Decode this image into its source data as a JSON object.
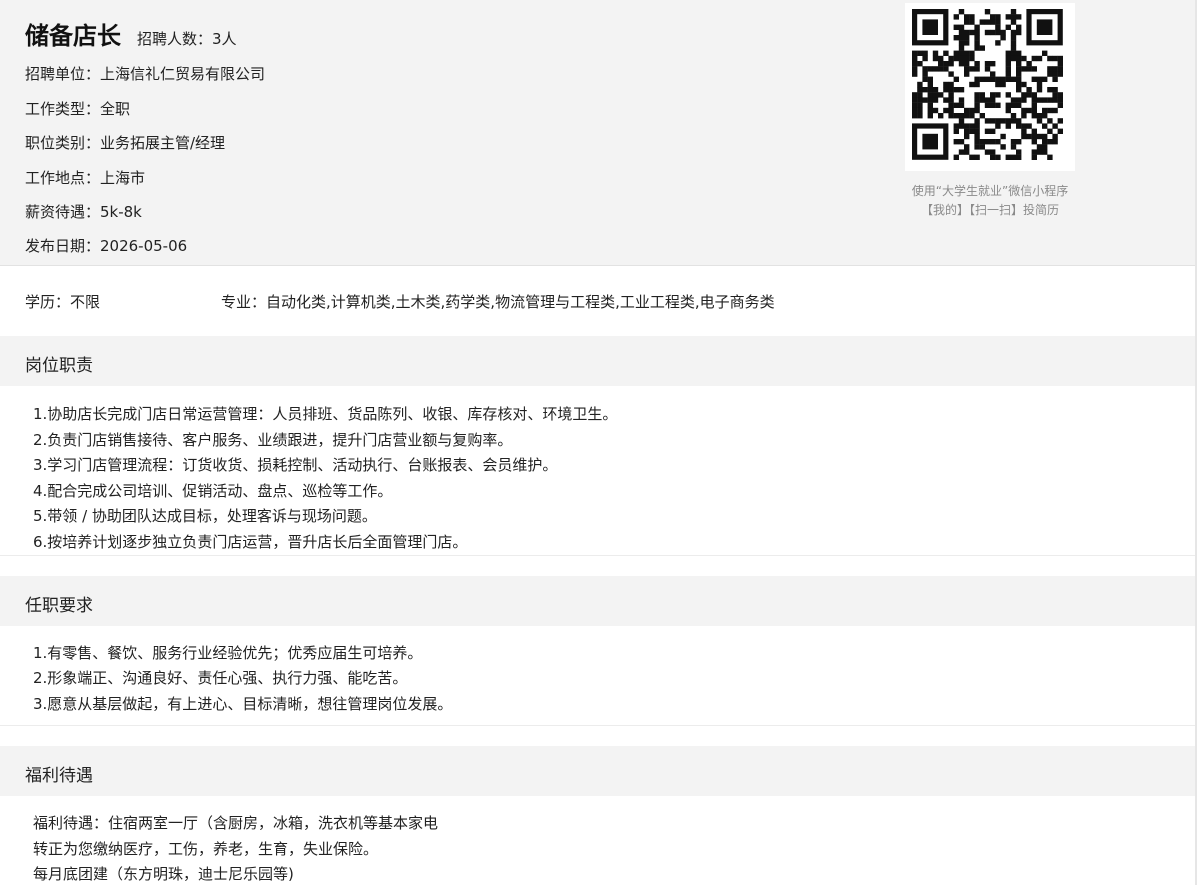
{
  "job": {
    "title": "储备店长",
    "headcount": "招聘人数：3人",
    "company": "招聘单位：上海信礼仁贸易有限公司",
    "work_type": "工作类型：全职",
    "category": "职位类别：业务拓展主管/经理",
    "location": "工作地点：上海市",
    "salary": "薪资待遇：5k-8k",
    "publish_date": "发布日期：2026-05-06"
  },
  "qr": {
    "caption_line1": "使用“大学生就业”微信小程序",
    "caption_line2": "【我的】【扫一扫】投简历"
  },
  "requirements": {
    "education": "学历：不限",
    "major": "专业：自动化类,计算机类,土木类,药学类,物流管理与工程类,工业工程类,电子商务类"
  },
  "sections": {
    "duties": {
      "heading": "岗位职责",
      "lines": [
        "1.协助店长完成门店日常运营管理：人员排班、货品陈列、收银、库存核对、环境卫生。",
        "2.负责门店销售接待、客户服务、业绩跟进，提升门店营业额与复购率。",
        "3.学习门店管理流程：订货收货、损耗控制、活动执行、台账报表、会员维护。",
        "4.配合完成公司培训、促销活动、盘点、巡检等工作。",
        "5.带领 / 协助团队达成目标，处理客诉与现场问题。",
        "6.按培养计划逐步独立负责门店运营，晋升店长后全面管理门店。"
      ]
    },
    "qualifications": {
      "heading": "任职要求",
      "lines": [
        "1.有零售、餐饮、服务行业经验优先；优秀应届生可培养。",
        "2.形象端正、沟通良好、责任心强、执行力强、能吃苦。",
        "3.愿意从基层做起，有上进心、目标清晰，想往管理岗位发展。"
      ]
    },
    "benefits": {
      "heading": "福利待遇",
      "lines": [
        "福利待遇：住宿两室一厅（含厨房，冰箱，洗衣机等基本家电",
        "转正为您缴纳医疗，工伤，养老，生育，失业保险。",
        "每月底团建（东方明珠，迪士尼乐园等)"
      ]
    }
  }
}
